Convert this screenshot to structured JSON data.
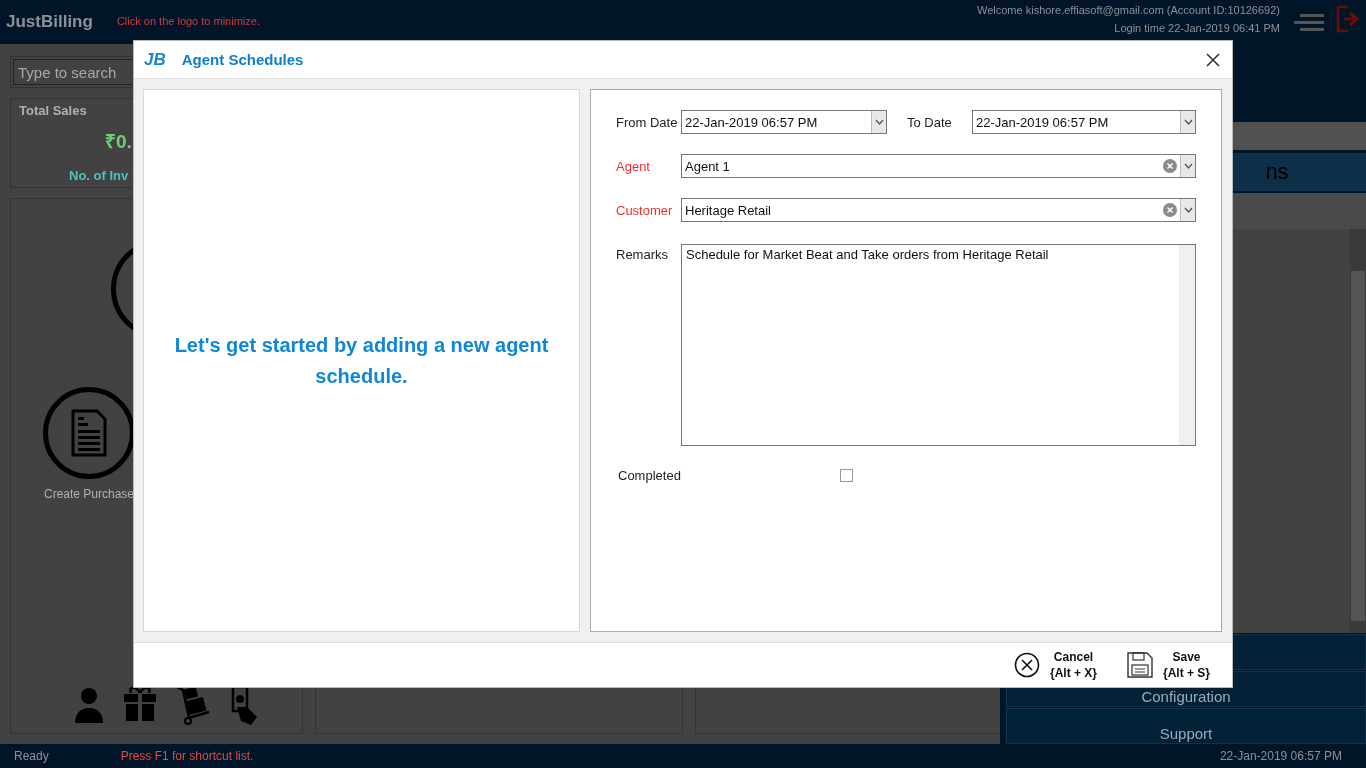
{
  "app": {
    "logo": "JustBilling",
    "hint": "Click on the logo to minimize.",
    "welcome": "Welcome kishore.effiasoft@gmail.com (Account ID:10126692)",
    "login_time": "Login time  22-Jan-2019 06:41 PM"
  },
  "search": {
    "placeholder": "Type to search"
  },
  "sales_card": {
    "title": "Total Sales",
    "amount": "₹0.",
    "count_label": "No. of Inv"
  },
  "tiles": [
    {
      "kind": "ring"
    },
    {
      "label": "Create Purchase",
      "kind": "document"
    }
  ],
  "right_panel": {
    "heading": "ns",
    "menu": [
      "Configuration",
      "Support"
    ]
  },
  "status_bar": {
    "status": "Ready",
    "hint": "Press F1 for shortcut list.",
    "time": "22-Jan-2019 06:57 PM"
  },
  "dialog": {
    "logo": "JB",
    "title": "Agent Schedules",
    "empty_message": "Let's get started by adding a new agent schedule.",
    "from_date": {
      "label": "From Date",
      "value": "22-Jan-2019 06:57 PM"
    },
    "to_date": {
      "label": "To Date",
      "value": "22-Jan-2019 06:57 PM"
    },
    "agent": {
      "label": "Agent",
      "value": "Agent 1",
      "required": true
    },
    "customer": {
      "label": "Customer",
      "value": "Heritage Retail",
      "required": true
    },
    "remarks": {
      "label": "Remarks",
      "value": "Schedule for Market Beat and Take orders from Heritage Retail"
    },
    "completed": {
      "label": "Completed",
      "checked": false
    },
    "buttons": [
      {
        "kind": "cancel",
        "label": "Cancel",
        "shortcut": "{Alt + X}"
      },
      {
        "kind": "save",
        "label": "Save",
        "shortcut": "{Alt + S}"
      }
    ]
  }
}
